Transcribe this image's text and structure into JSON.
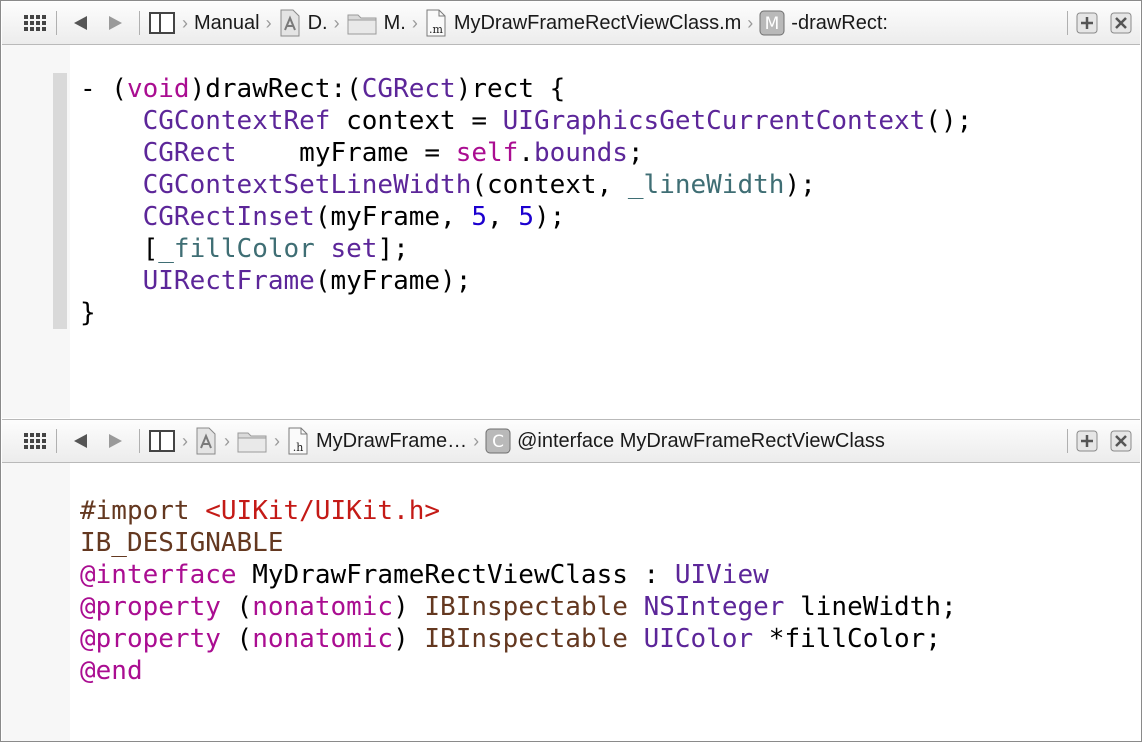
{
  "top_pane": {
    "jump_bar": {
      "related_items_icon": "grid-icon",
      "back_icon": "back-arrow-icon",
      "forward_icon": "forward-arrow-icon",
      "layout_icon": "split-layout-icon",
      "breadcrumbs": [
        {
          "icon": "none",
          "label": "Manual"
        },
        {
          "icon": "project-icon",
          "label": "D."
        },
        {
          "icon": "folder-icon",
          "label": "M."
        },
        {
          "icon": "m-file-icon",
          "icon_text": ".m",
          "label": "MyDrawFrameRectViewClass.m"
        },
        {
          "icon": "method-icon",
          "icon_text": "M",
          "label": "-drawRect:"
        }
      ],
      "add_icon": "add-editor-icon",
      "close_icon": "close-editor-icon"
    },
    "code_lines": [
      [
        [
          "- (",
          "id"
        ],
        [
          "void",
          "key"
        ],
        [
          ")drawRect:(",
          "id"
        ],
        [
          "CGRect",
          "type"
        ],
        [
          ")rect {",
          "id"
        ]
      ],
      [
        [
          "    ",
          "id"
        ],
        [
          "CGContextRef",
          "type"
        ],
        [
          " context = ",
          "id"
        ],
        [
          "UIGraphicsGetCurrentContext",
          "fn"
        ],
        [
          "();",
          "id"
        ]
      ],
      [
        [
          "    ",
          "id"
        ],
        [
          "CGRect",
          "type"
        ],
        [
          "    myFrame = ",
          "id"
        ],
        [
          "self",
          "key"
        ],
        [
          ".",
          "id"
        ],
        [
          "bounds",
          "fn"
        ],
        [
          ";",
          "id"
        ]
      ],
      [
        [
          "    ",
          "id"
        ],
        [
          "CGContextSetLineWidth",
          "fn"
        ],
        [
          "(context, ",
          "id"
        ],
        [
          "_lineWidth",
          "ivar"
        ],
        [
          ");",
          "id"
        ]
      ],
      [
        [
          "    ",
          "id"
        ],
        [
          "CGRectInset",
          "fn"
        ],
        [
          "(myFrame, ",
          "id"
        ],
        [
          "5",
          "num"
        ],
        [
          ", ",
          "id"
        ],
        [
          "5",
          "num"
        ],
        [
          ");",
          "id"
        ]
      ],
      [
        [
          "    [",
          "id"
        ],
        [
          "_fillColor",
          "ivar"
        ],
        [
          " ",
          "id"
        ],
        [
          "set",
          "fn"
        ],
        [
          "];",
          "id"
        ]
      ],
      [
        [
          "    ",
          "id"
        ],
        [
          "UIRectFrame",
          "fn"
        ],
        [
          "(myFrame);",
          "id"
        ]
      ],
      [
        [
          "}",
          "id"
        ]
      ]
    ]
  },
  "bottom_pane": {
    "jump_bar": {
      "related_items_icon": "grid-icon",
      "back_icon": "back-arrow-icon",
      "forward_icon": "forward-arrow-icon",
      "layout_icon": "split-layout-icon",
      "breadcrumbs": [
        {
          "icon": "project-icon",
          "label": ""
        },
        {
          "icon": "folder-icon",
          "label": ""
        },
        {
          "icon": "h-file-icon",
          "icon_text": ".h",
          "label": "MyDrawFrame…"
        },
        {
          "icon": "class-icon",
          "icon_text": "C",
          "label": "@interface MyDrawFrameRectViewClass"
        }
      ],
      "add_icon": "add-editor-icon",
      "close_icon": "close-editor-icon"
    },
    "code_lines": [
      [
        [
          "#import ",
          "pre"
        ],
        [
          "<UIKit/UIKit.h>",
          "str"
        ]
      ],
      [
        [
          "IB_DESIGNABLE",
          "pre"
        ]
      ],
      [
        [
          "@interface",
          "key"
        ],
        [
          " MyDrawFrameRectViewClass : ",
          "id"
        ],
        [
          "UIView",
          "type"
        ]
      ],
      [
        [
          "@property",
          "key"
        ],
        [
          " (",
          "id"
        ],
        [
          "nonatomic",
          "key"
        ],
        [
          ") ",
          "id"
        ],
        [
          "IBInspectable",
          "pre"
        ],
        [
          " ",
          "id"
        ],
        [
          "NSInteger",
          "type"
        ],
        [
          " lineWidth;",
          "id"
        ]
      ],
      [
        [
          "@property",
          "key"
        ],
        [
          " (",
          "id"
        ],
        [
          "nonatomic",
          "key"
        ],
        [
          ") ",
          "id"
        ],
        [
          "IBInspectable",
          "pre"
        ],
        [
          " ",
          "id"
        ],
        [
          "UIColor",
          "type"
        ],
        [
          " *fillColor;",
          "id"
        ]
      ],
      [
        [
          "@end",
          "key"
        ]
      ]
    ]
  },
  "colors": {
    "keyword": "#aa0d91",
    "type": "#5c2699",
    "number": "#1c00cf",
    "ivar": "#3f6e74",
    "preprocessor": "#643820",
    "string": "#c41a16"
  }
}
